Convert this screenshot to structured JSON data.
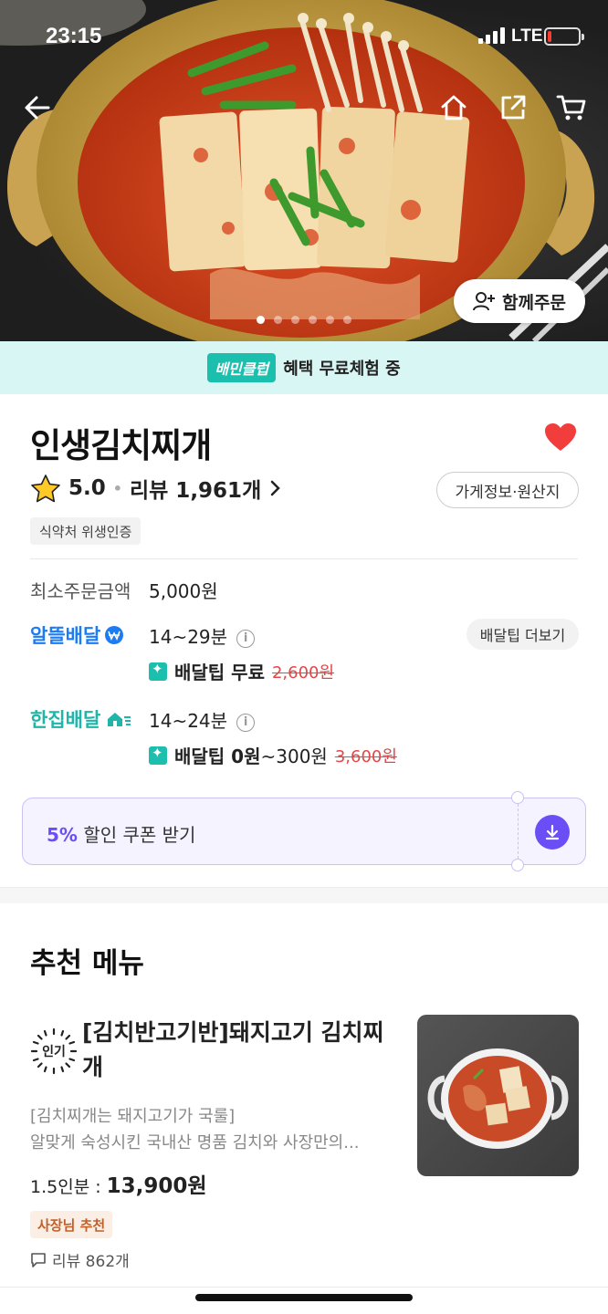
{
  "status_bar": {
    "time": "23:15",
    "network": "LTE"
  },
  "hero": {
    "group_order_label": "함께주문",
    "page_dots": 6,
    "active_dot": 0
  },
  "club_banner": {
    "tag": "배민클럽",
    "text": "혜택 무료체험 중"
  },
  "store": {
    "name": "인생김치찌개",
    "rating": "5.0",
    "review_label": "리뷰 1,961개",
    "info_button": "가게정보·원산지",
    "hygiene_badge": "식약처 위생인증",
    "favorited": true
  },
  "order": {
    "min_label": "최소주문금액",
    "min_value": "5,000원",
    "alddeul": {
      "brand": "알뜰배달",
      "time": "14~29분",
      "tip_label": "배달팁 무료",
      "tip_original": "2,600원",
      "more_button": "배달팁 더보기"
    },
    "hanjip": {
      "brand": "한집배달",
      "time": "14~24분",
      "tip_label": "배달팁 0원",
      "tip_range": "~300원",
      "tip_original": "3,600원"
    }
  },
  "coupon": {
    "percent": "5%",
    "text": "할인 쿠폰 받기"
  },
  "recommended": {
    "title": "추천 메뉴",
    "items": [
      {
        "badge": "인기",
        "name": "[김치반고기반]돼지고기 김치찌개",
        "desc_line1": "[김치찌개는 돼지고기가 국룰]",
        "desc_line2": "알맞게 숙성시킨 국내산 명품 김치와 사장만의...",
        "portion": "1.5인분 : ",
        "price": "13,900원",
        "owner_badge": "사장님 추천",
        "reviews": "리뷰 862개"
      }
    ]
  },
  "colors": {
    "accent_purple": "#6b4ef5",
    "mint": "#1bbfae",
    "alddeul_blue": "#1e7cf2",
    "heart_red": "#f23d3d"
  }
}
